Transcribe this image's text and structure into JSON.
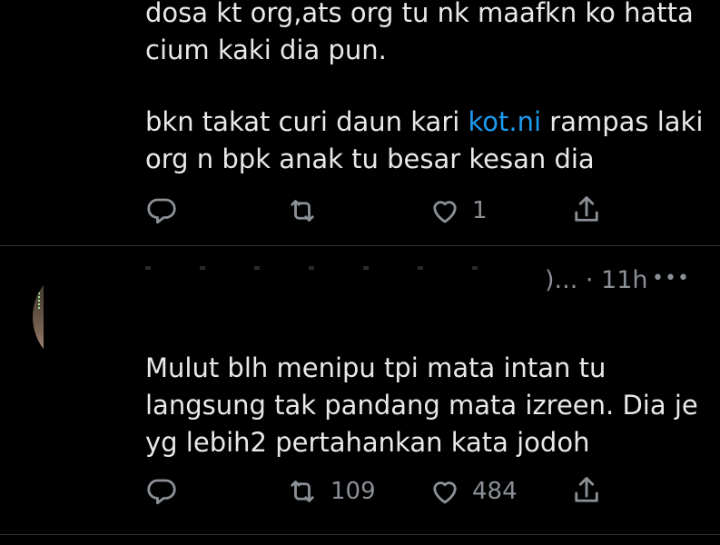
{
  "tweet1": {
    "lines": [
      "dosa kt org,ats org tu nk maafkn ko hatta",
      "cium kaki dia pun.",
      "bkn takat curi daun kari ",
      "kot.ni",
      " rampas laki",
      "org n bpk anak tu besar kesan dia"
    ],
    "likes": "1"
  },
  "tweet2": {
    "meta": ")... · 11h",
    "more": "•••",
    "lines": [
      "Mulut blh menipu tpi mata intan tu",
      "langsung tak pandang mata izreen. Dia je",
      "yg lebih2 pertahankan kata jodoh"
    ],
    "retweets": "109",
    "likes": "484"
  },
  "colors": {
    "background": "#000000",
    "text": "#e7e9ea",
    "muted": "#8b9096",
    "link": "#1d9bf0",
    "divider": "#2f3336"
  },
  "icons": [
    "reply-icon",
    "retweet-icon",
    "like-icon",
    "share-icon",
    "more-icon"
  ]
}
